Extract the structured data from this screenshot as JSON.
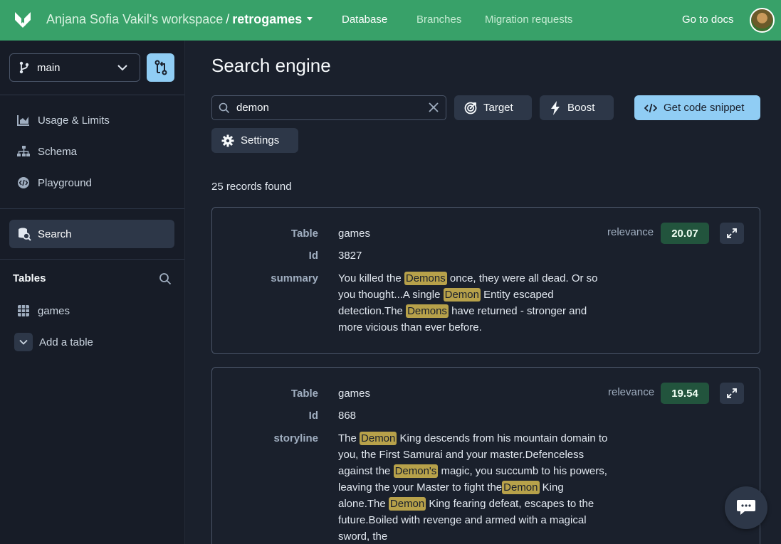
{
  "topbar": {
    "workspace": "Anjana Sofia Vakil's workspace",
    "separator": "/",
    "database": "retrogames",
    "nav": [
      "Database",
      "Branches",
      "Migration requests"
    ],
    "docs": "Go to docs"
  },
  "sidebar": {
    "branch": "main",
    "items": [
      {
        "label": "Usage & Limits",
        "icon": "bar-chart-icon"
      },
      {
        "label": "Schema",
        "icon": "hierarchy-icon"
      },
      {
        "label": "Playground",
        "icon": "code-icon"
      }
    ],
    "search_label": "Search",
    "tables_title": "Tables",
    "tables": [
      {
        "label": "games",
        "icon": "grid-icon"
      }
    ],
    "add_table": "Add a table"
  },
  "main": {
    "title": "Search engine",
    "search": {
      "value": "demon"
    },
    "buttons": {
      "target": "Target",
      "boost": "Boost",
      "settings": "Settings",
      "snippet": "Get code snippet"
    },
    "count_text": "25 records found",
    "relevance_label": "relevance",
    "results": [
      {
        "relevance": "20.07",
        "table_label": "Table",
        "table": "games",
        "id_label": "Id",
        "id": "3827",
        "field_label": "summary",
        "text_parts": [
          {
            "t": "You killed the "
          },
          {
            "t": "Demons",
            "hl": true
          },
          {
            "t": " once, they were all dead. Or so you thought...A single "
          },
          {
            "t": "Demon",
            "hl": true
          },
          {
            "t": " Entity escaped detection.The "
          },
          {
            "t": "Demons",
            "hl": true
          },
          {
            "t": " have returned - stronger and more vicious than ever before."
          }
        ]
      },
      {
        "relevance": "19.54",
        "table_label": "Table",
        "table": "games",
        "id_label": "Id",
        "id": "868",
        "field_label": "storyline",
        "text_parts": [
          {
            "t": "The "
          },
          {
            "t": "Demon",
            "hl": true
          },
          {
            "t": " King descends from his mountain domain to you, the First Samurai and your master.Defenceless against the "
          },
          {
            "t": "Demon's",
            "hl": true
          },
          {
            "t": " magic, you succumb to his powers, leaving the your Master to fight the"
          },
          {
            "t": "Demon",
            "hl": true
          },
          {
            "t": " King alone.The "
          },
          {
            "t": "Demon",
            "hl": true
          },
          {
            "t": " King fearing defeat, escapes to the future.Boiled with revenge and armed with a magical sword, the"
          }
        ]
      }
    ]
  },
  "colors": {
    "topbar": "#38a169",
    "accent": "#90cdf4",
    "relevance": "#22543d",
    "highlight": "#b7a14a"
  }
}
